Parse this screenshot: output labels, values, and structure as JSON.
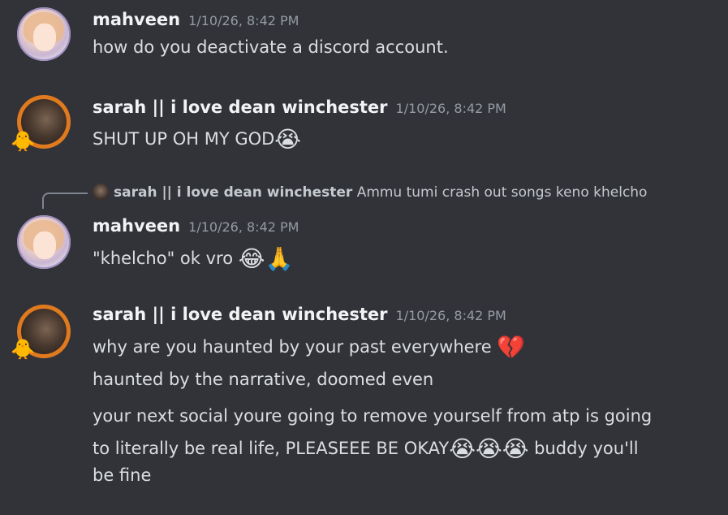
{
  "messages": [
    {
      "author": "mahveen",
      "timestamp": "1/10/26, 8:42 PM",
      "lines": [
        "how do you deactivate a discord account."
      ]
    },
    {
      "author": "sarah || i love dean winchester",
      "timestamp": "1/10/26, 8:42 PM",
      "lines": [
        "SHUT UP OH MY GOD"
      ],
      "emoji": [
        "😭"
      ]
    },
    {
      "reply_to": {
        "author": "sarah || i love dean winchester",
        "text": "Ammu tumi crash out songs keno khelcho"
      },
      "author": "mahveen",
      "timestamp": "1/10/26, 8:42 PM",
      "lines": [
        "\"khelcho\" ok vro"
      ],
      "emoji": [
        "😂",
        "🙏"
      ]
    },
    {
      "author": "sarah || i love dean winchester",
      "timestamp": "1/10/26, 8:42 PM",
      "lines": [
        "why are you haunted by your past everywhere",
        "haunted by the narrative, doomed even",
        "your next social youre going to remove yourself from atp is going",
        "to literally be real life, PLEASEEE BE OKAY",
        "buddy you'll",
        "be fine"
      ],
      "emoji_line1": [
        "💔"
      ],
      "emoji_line4": [
        "😭",
        "😭",
        "😭"
      ]
    }
  ]
}
